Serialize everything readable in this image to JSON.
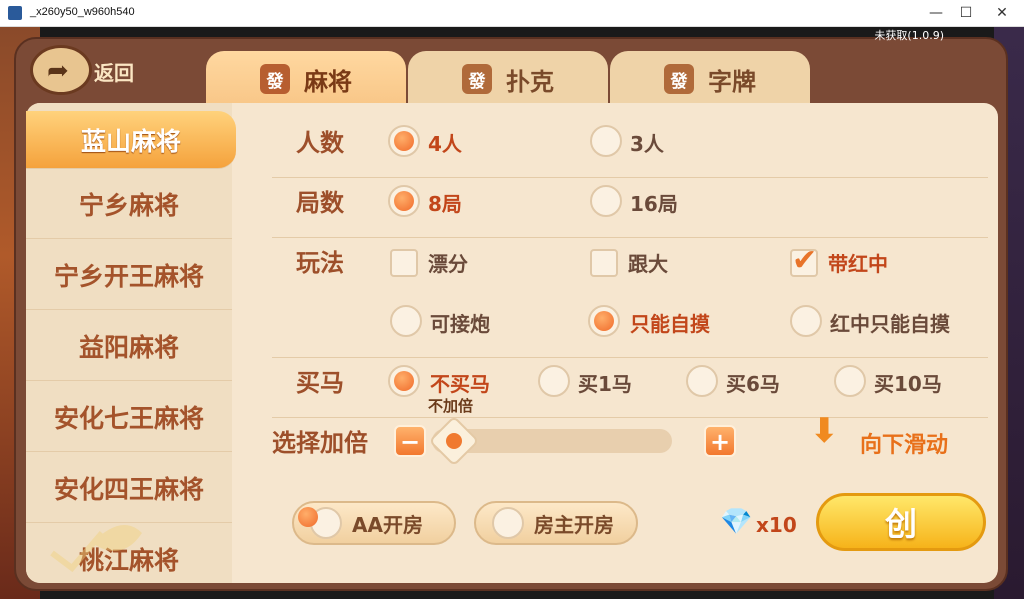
{
  "window": {
    "title": "_x260y50_w960h540",
    "minimize": "—",
    "maximize": "☐",
    "close": "✕"
  },
  "version": "未获取(1.0.9)",
  "back_label": "返回",
  "tabs": [
    {
      "tile": "發",
      "label": "麻将",
      "active": true
    },
    {
      "tile": "發",
      "label": "扑克",
      "active": false
    },
    {
      "tile": "發",
      "label": "字牌",
      "active": false
    }
  ],
  "sidebar": [
    {
      "label": "蓝山麻将",
      "active": true
    },
    {
      "label": "宁乡麻将"
    },
    {
      "label": "宁乡开王麻将"
    },
    {
      "label": "益阳麻将"
    },
    {
      "label": "安化七王麻将"
    },
    {
      "label": "安化四王麻将"
    },
    {
      "label": "桃江麻将"
    }
  ],
  "players": {
    "label": "人数",
    "options": [
      "4人",
      "3人"
    ],
    "selected": "4人"
  },
  "rounds": {
    "label": "局数",
    "options": [
      "8局",
      "16局"
    ],
    "selected": "8局"
  },
  "rules": {
    "label": "玩法",
    "checkboxes": [
      {
        "label": "漂分",
        "checked": false
      },
      {
        "label": "跟大",
        "checked": false
      },
      {
        "label": "带红中",
        "checked": true
      }
    ],
    "radios": [
      {
        "label": "可接炮",
        "selected": false
      },
      {
        "label": "只能自摸",
        "selected": true
      },
      {
        "label": "红中只能自摸",
        "selected": false
      }
    ]
  },
  "horse": {
    "label": "买马",
    "options": [
      "不买马",
      "买1马",
      "买6马",
      "买10马"
    ],
    "selected": "不买马"
  },
  "multiplier": {
    "label": "选择加倍",
    "value_text": "不加倍",
    "minus": "−",
    "plus": "+",
    "level": 0
  },
  "scroll_hint": "向下滑动",
  "room_modes": [
    {
      "label": "AA开房",
      "selected": true
    },
    {
      "label": "房主开房",
      "selected": false
    }
  ],
  "cost": {
    "icon": "diamond-icon",
    "text": "x10"
  },
  "create_label": "创"
}
